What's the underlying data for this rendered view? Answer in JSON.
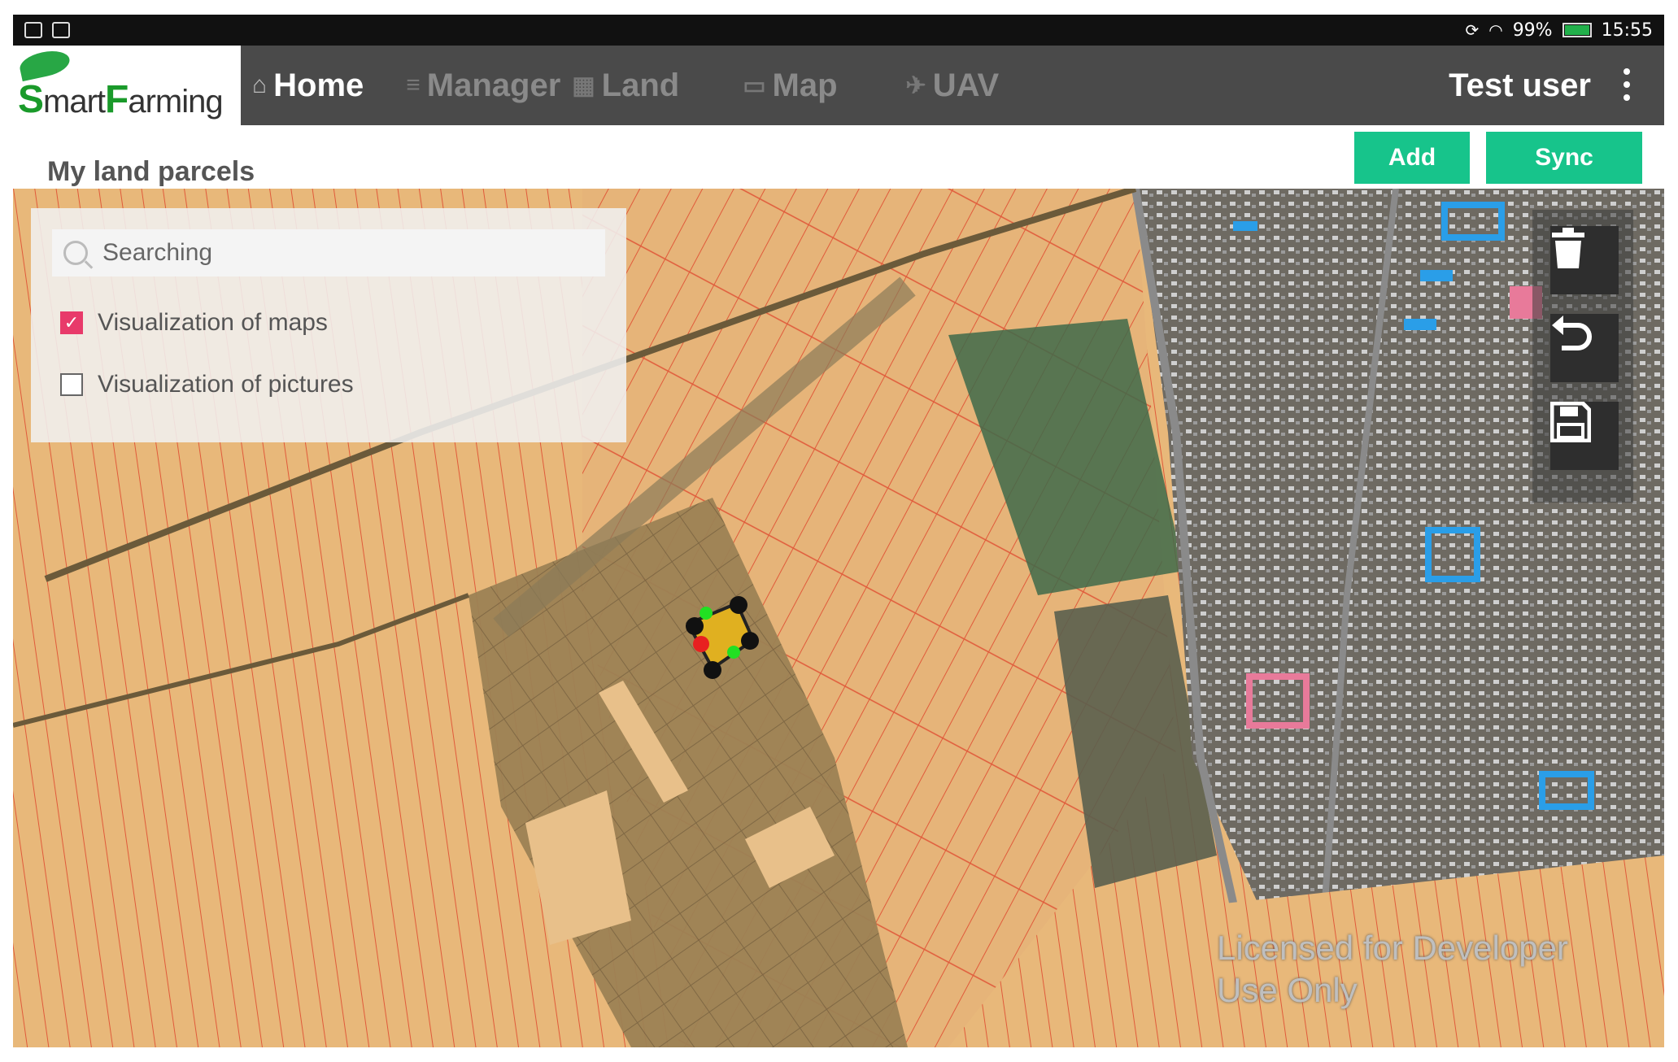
{
  "status_bar": {
    "battery": "99%",
    "battery_level": 0.99,
    "time": "15:55"
  },
  "app": {
    "logo": {
      "prefix": "S",
      "part1": "mart",
      "accent": "F",
      "part2": "arming"
    }
  },
  "nav": {
    "items": [
      {
        "label": "Home",
        "icon": "home-icon",
        "active": true
      },
      {
        "label": "Manager",
        "icon": "list-icon",
        "active": false
      },
      {
        "label": "Land",
        "icon": "grid-icon",
        "active": false
      },
      {
        "label": "Map",
        "icon": "map-icon",
        "active": false
      },
      {
        "label": "UAV",
        "icon": "drone-icon",
        "active": false
      }
    ],
    "user": "Test user"
  },
  "toolbar": {
    "title": "My land parcels",
    "add_label": "Add",
    "sync_label": "Sync"
  },
  "panel": {
    "search_placeholder": "Searching",
    "options": [
      {
        "label": "Visualization of maps",
        "checked": true
      },
      {
        "label": "Visualization of pictures",
        "checked": false
      }
    ]
  },
  "tools": [
    {
      "icon": "trash-icon"
    },
    {
      "icon": "undo-icon"
    },
    {
      "icon": "save-icon"
    }
  ],
  "map": {
    "watermark_line1": "Licensed for Developer",
    "watermark_line2": "Use Only"
  },
  "colors": {
    "accent": "#17c48b",
    "nav_bg": "#4a4a4a",
    "check": "#e83a6a",
    "parcel_fill": "#e8b87a",
    "parcel_stroke": "#e05a3a",
    "building_blue": "#2a9ee8"
  }
}
